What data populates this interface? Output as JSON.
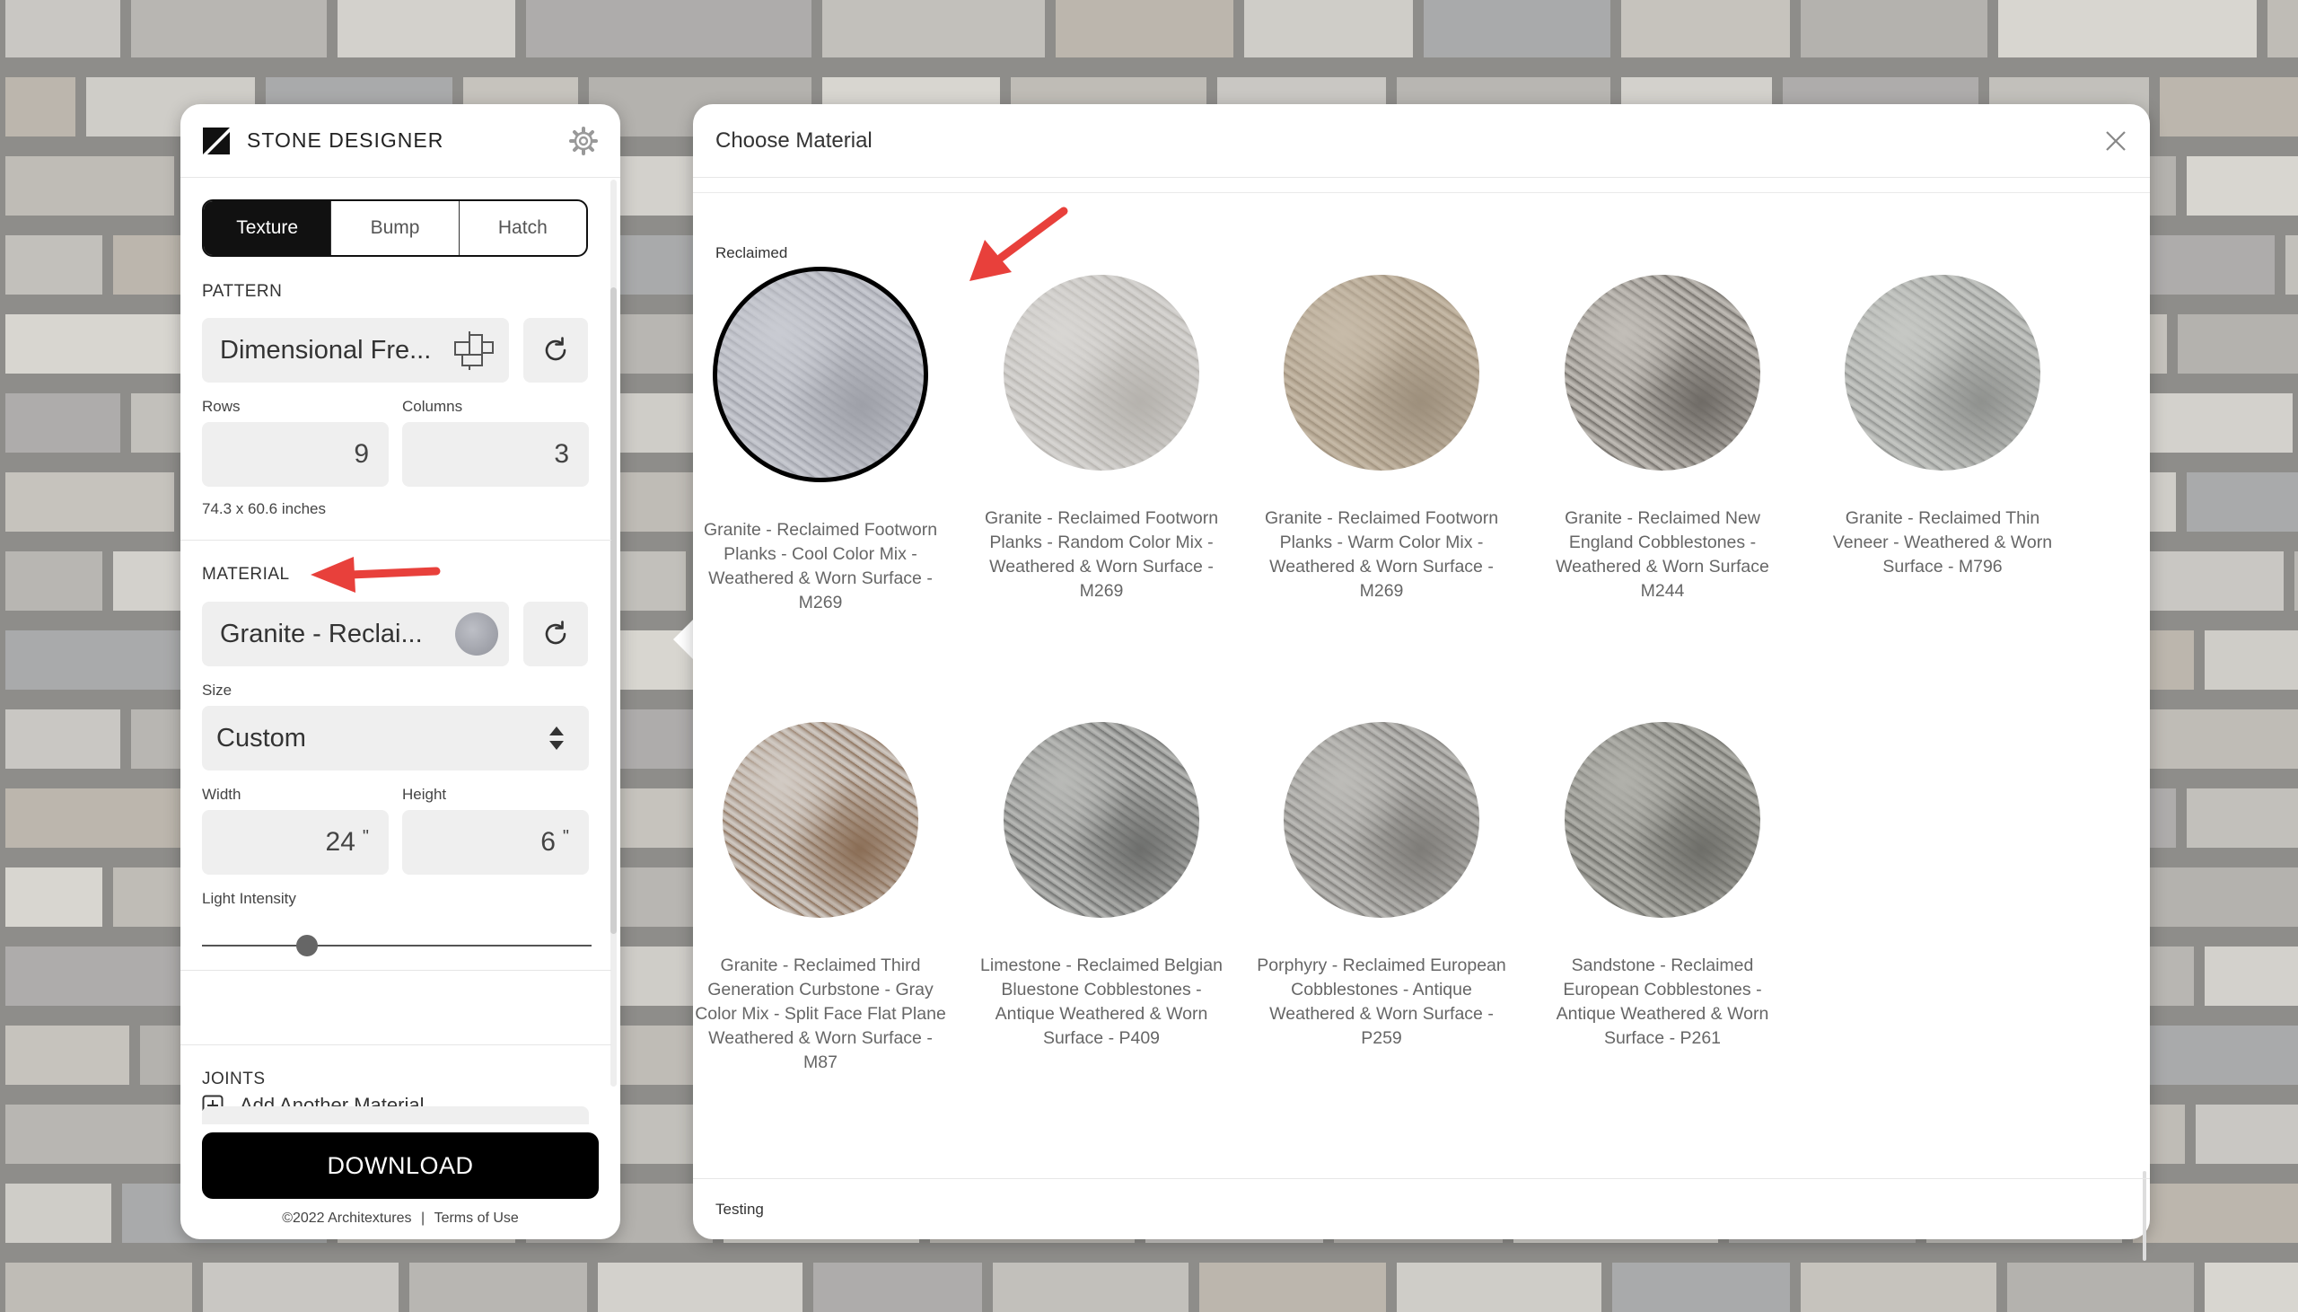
{
  "app": {
    "title": "STONE DESIGNER"
  },
  "tabs": [
    {
      "label": "Texture",
      "active": true
    },
    {
      "label": "Bump",
      "active": false
    },
    {
      "label": "Hatch",
      "active": false
    }
  ],
  "pattern": {
    "heading": "PATTERN",
    "value": "Dimensional Fre...",
    "rows_label": "Rows",
    "rows_value": "9",
    "columns_label": "Columns",
    "columns_value": "3",
    "dimensions_text": "74.3 x 60.6 inches"
  },
  "material": {
    "heading": "MATERIAL",
    "value": "Granite - Reclai...",
    "size_label": "Size",
    "size_value": "Custom",
    "width_label": "Width",
    "width_value": "24",
    "height_label": "Height",
    "height_value": "6",
    "unit": "\"",
    "light_label": "Light Intensity",
    "light_intensity": 0.27
  },
  "add_material_label": "Add Another Material",
  "joints_heading": "JOINTS",
  "download_label": "DOWNLOAD",
  "footer": {
    "copyright": "©2022 Architextures",
    "separator": "|",
    "terms": "Terms of Use"
  },
  "modal": {
    "title": "Choose Material",
    "group": "Reclaimed",
    "footer_label": "Testing",
    "materials": [
      {
        "name": "Granite - Reclaimed Footworn Planks - Cool Color Mix - Weathered & Worn Surface - M269",
        "selected": true,
        "colors": [
          "#b9bbc3",
          "#9ea0a8",
          "#c9cbd2"
        ]
      },
      {
        "name": "Granite - Reclaimed Footworn Planks - Random Color Mix - Weathered & Worn Surface - M269",
        "selected": false,
        "colors": [
          "#cbc9c6",
          "#b5b2ad",
          "#d8d6d3"
        ]
      },
      {
        "name": "Granite - Reclaimed Footworn Planks - Warm Color Mix - Weathered & Worn Surface - M269",
        "selected": false,
        "colors": [
          "#b7a995",
          "#9d8f7c",
          "#c7bba9"
        ]
      },
      {
        "name": "Granite - Reclaimed New England Cobblestones - Weathered & Worn Surface M244",
        "selected": false,
        "colors": [
          "#a29e98",
          "#6f6b66",
          "#c2beb8"
        ]
      },
      {
        "name": "Granite - Reclaimed Thin Veneer - Weathered & Worn Surface - M796",
        "selected": false,
        "colors": [
          "#b3b5b2",
          "#8f918e",
          "#c6c8c4"
        ]
      },
      {
        "name": "Granite - Reclaimed Third Generation Curbstone - Gray Color Mix - Split Face Flat Plane Weathered & Worn Surface - M87",
        "selected": false,
        "colors": [
          "#b6aaa0",
          "#8a6d55",
          "#d2cbc4"
        ]
      },
      {
        "name": "Limestone - Reclaimed Belgian Bluestone Cobblestones - Antique Weathered & Worn Surface - P409",
        "selected": false,
        "colors": [
          "#9a9b99",
          "#6d6e6c",
          "#b9bab7"
        ]
      },
      {
        "name": "Porphyry - Reclaimed European Cobblestones - Antique Weathered & Worn Surface - P259",
        "selected": false,
        "colors": [
          "#a3a29f",
          "#7e7c78",
          "#bdbcb8"
        ]
      },
      {
        "name": "Sandstone - Reclaimed European Cobblestones - Antique Weathered & Worn Surface - P261",
        "selected": false,
        "colors": [
          "#95958f",
          "#6e6e69",
          "#b1b1ab"
        ]
      }
    ]
  }
}
